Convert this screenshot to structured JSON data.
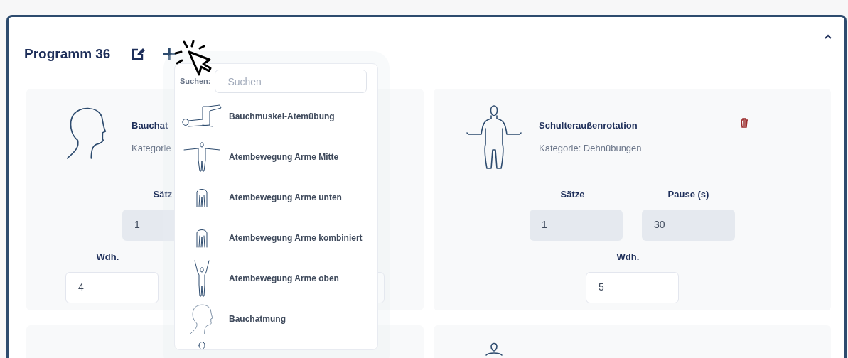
{
  "program": {
    "title": "Programm 36",
    "expanded": true
  },
  "exercises": [
    {
      "kind": "head",
      "name": "Bauchat",
      "category": "Kategorie",
      "delete_icon": false,
      "rows": [
        [
          {
            "kind": "value",
            "label": "Sätz",
            "value": "1",
            "editable": false
          },
          {
            "kind": "covered"
          }
        ],
        [
          {
            "kind": "value",
            "label": "Wdh.",
            "value": "4",
            "editable": true
          },
          {
            "kind": "blank",
            "editable": true
          }
        ]
      ]
    },
    {
      "kind": "seated",
      "name": "Schulteraußenrotation",
      "category": "Kategorie: Dehnübungen",
      "delete_icon": true,
      "rows": [
        [
          {
            "kind": "value",
            "label": "Sätze",
            "value": "1",
            "editable": false
          },
          {
            "kind": "value",
            "label": "Pause (s)",
            "value": "30",
            "editable": false
          }
        ],
        [
          {
            "kind": "value",
            "label": "Wdh.",
            "value": "5",
            "editable": true
          }
        ]
      ]
    },
    {
      "kind": "none"
    },
    {
      "kind": "head-small"
    }
  ],
  "picker": {
    "search_label": "Suchen:",
    "placeholder": "Suchen",
    "items": [
      {
        "kind": "lying",
        "name": "Bauchmuskel-Atemübung"
      },
      {
        "kind": "arms-side",
        "name": "Atembewegung Arme Mitte"
      },
      {
        "kind": "arms-down",
        "name": "Atembewegung Arme unten"
      },
      {
        "kind": "arms-down",
        "name": "Atembewegung Arme kombiniert"
      },
      {
        "kind": "arms-up",
        "name": "Atembewegung Arme oben"
      },
      {
        "kind": "head",
        "name": "Bauchatmung"
      },
      {
        "kind": "head-small"
      }
    ]
  }
}
